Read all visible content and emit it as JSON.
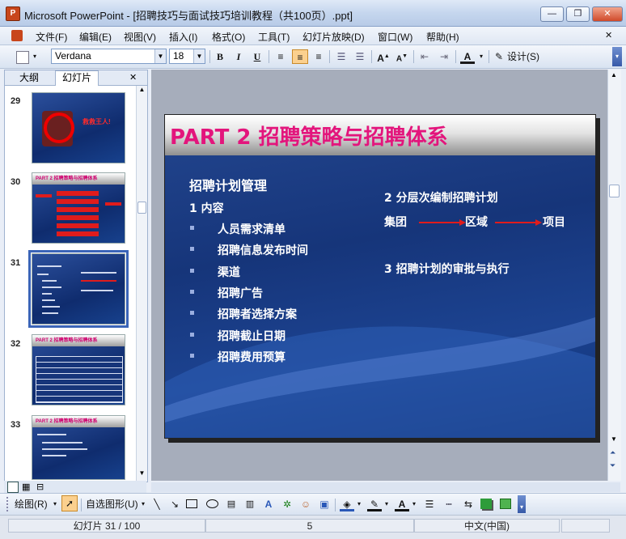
{
  "window": {
    "title": "Microsoft PowerPoint - [招聘技巧与面试技巧培训教程（共100页）.ppt]",
    "app_icon_label": "P",
    "minimize": "—",
    "restore": "❐",
    "close": "✕"
  },
  "menu": {
    "items": [
      "文件(F)",
      "编辑(E)",
      "视图(V)",
      "插入(I)",
      "格式(O)",
      "工具(T)",
      "幻灯片放映(D)",
      "窗口(W)",
      "帮助(H)"
    ],
    "doc_close": "✕"
  },
  "toolbar": {
    "font_name": "Verdana",
    "font_size": "18",
    "bold": "B",
    "italic": "I",
    "underline": "U",
    "design_label": "设计(S)"
  },
  "left_panel": {
    "tab_outline": "大纲",
    "tab_slides": "幻灯片",
    "close": "✕",
    "thumbnails": [
      {
        "number": "29",
        "caption": "救救王人!"
      },
      {
        "number": "30",
        "title": "PART 2 招聘策略与招聘体系"
      },
      {
        "number": "31",
        "title": "PART 2 招聘策略与招聘体系",
        "selected": true
      },
      {
        "number": "32",
        "title": "PART 2 招聘策略与招聘体系"
      },
      {
        "number": "33",
        "title": "PART 2 招聘策略与招聘体系"
      }
    ]
  },
  "slide": {
    "title": "PART 2  招聘策略与招聘体系",
    "left_heading": "招聘计划管理",
    "item1": "1    内容",
    "bullets": [
      "人员需求清单",
      "招聘信息发布时间",
      "渠道",
      "招聘广告",
      "招聘者选择方案",
      "招聘截止日期",
      "招聘费用预算"
    ],
    "item2": "2    分层次编制招聘计划",
    "flow": [
      "集团",
      "区域",
      "项目"
    ],
    "item3": "3    招聘计划的审批与执行"
  },
  "drawing_toolbar": {
    "draw_label": "绘图(R)",
    "autoshapes_label": "自选图形(U)"
  },
  "status": {
    "slide_info": "幻灯片 31 / 100",
    "design_count": "5",
    "language": "中文(中国)"
  }
}
